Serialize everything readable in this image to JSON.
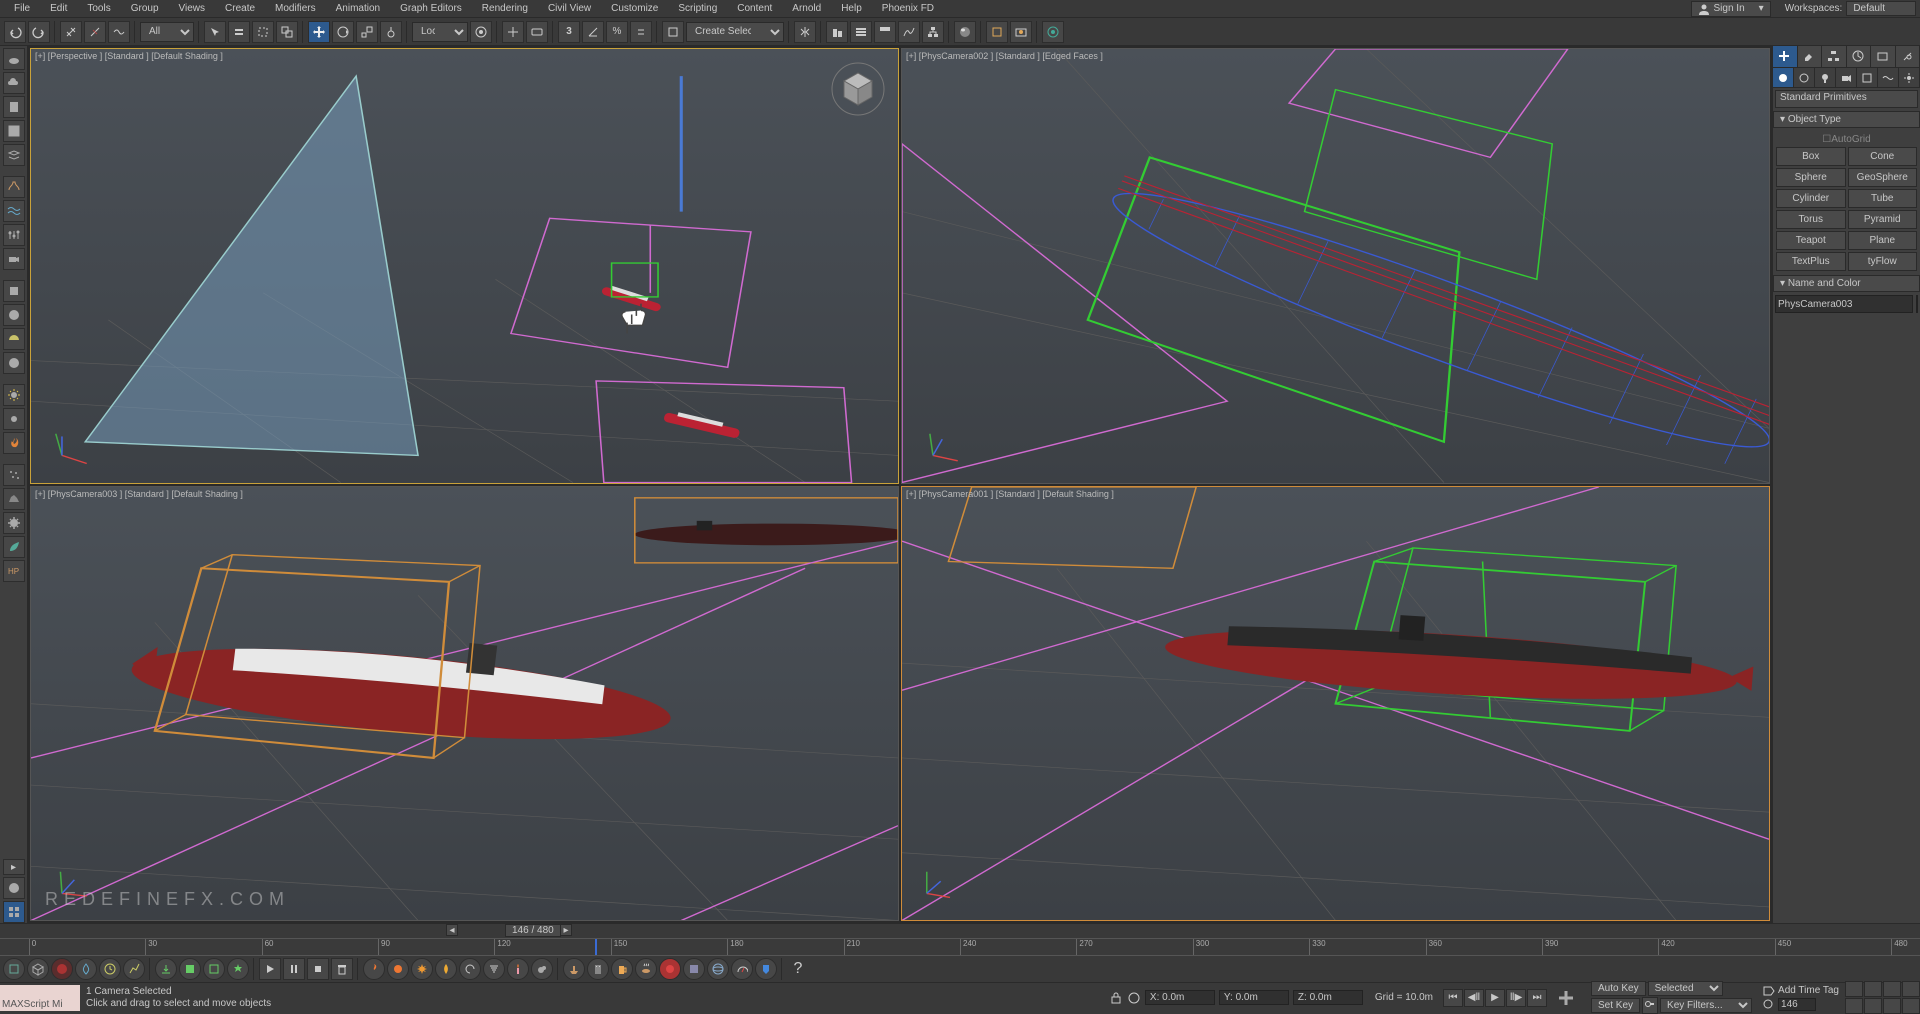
{
  "menu": [
    "File",
    "Edit",
    "Tools",
    "Group",
    "Views",
    "Create",
    "Modifiers",
    "Animation",
    "Graph Editors",
    "Rendering",
    "Civil View",
    "Customize",
    "Scripting",
    "Content",
    "Arnold",
    "Help",
    "Phoenix FD"
  ],
  "sign_in": "Sign In",
  "workspace_label": "Workspaces:",
  "workspace_value": "Default",
  "toolbar": {
    "obj_filter": "All",
    "ref_coord": "Local",
    "named_sel": "Create Selection Se"
  },
  "viewports": {
    "tl": "[+] [Perspective ] [Standard ] [Default Shading ]",
    "tr": "[+] [PhysCamera002 ] [Standard ] [Edged Faces ]",
    "bl": "[+] [PhysCamera003 ] [Standard ] [Default Shading ]",
    "br": "[+] [PhysCamera001 ] [Standard ] [Default Shading ]",
    "rfx": "REDEFINEFX.COM"
  },
  "cmd": {
    "dropdown": "Standard Primitives",
    "rollout_objtype": "Object Type",
    "autogrid": "AutoGrid",
    "buttons": [
      "Box",
      "Cone",
      "Sphere",
      "GeoSphere",
      "Cylinder",
      "Tube",
      "Torus",
      "Pyramid",
      "Teapot",
      "Plane",
      "TextPlus",
      "tyFlow"
    ],
    "rollout_name": "Name and Color",
    "obj_name": "PhysCamera003"
  },
  "timeline": {
    "frame_label": "146 / 480",
    "ticks": [
      0,
      30,
      60,
      90,
      120,
      150,
      180,
      210,
      240,
      270,
      300,
      330,
      360,
      390,
      420,
      450,
      480
    ],
    "current": 146
  },
  "status": {
    "maxscript": "MAXScript Mi",
    "line1": "1 Camera Selected",
    "line2": "Click and drag to select and move objects",
    "x": "X: 0.0m",
    "y": "Y: 0.0m",
    "z": "Z: 0.0m",
    "grid": "Grid = 10.0m",
    "add_tag": "Add Time Tag",
    "autokey": "Auto Key",
    "setkey": "Set Key",
    "selected": "Selected",
    "keyfilters": "Key Filters...",
    "frame": "146"
  }
}
